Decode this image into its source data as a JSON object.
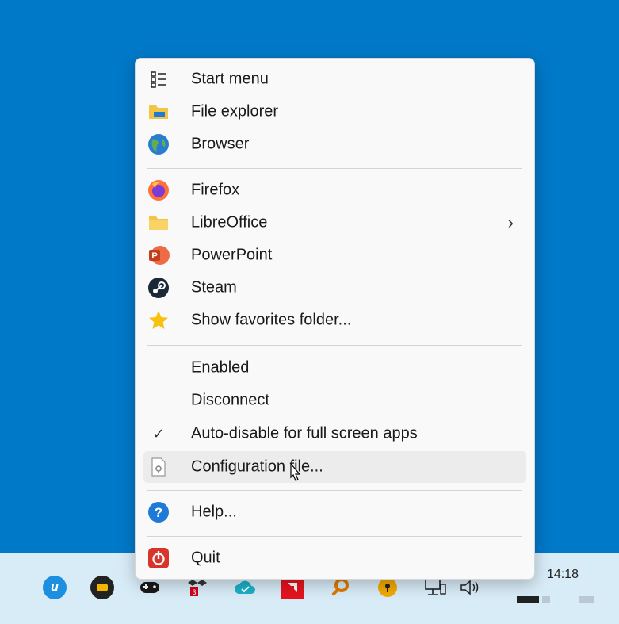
{
  "menu": {
    "items": [
      {
        "label": "Start menu",
        "icon": "start-menu-icon"
      },
      {
        "label": "File explorer",
        "icon": "folder-explorer-icon"
      },
      {
        "label": "Browser",
        "icon": "globe-icon"
      },
      {
        "label": "Firefox",
        "icon": "firefox-icon"
      },
      {
        "label": "LibreOffice",
        "icon": "folder-icon",
        "submenu": true
      },
      {
        "label": "PowerPoint",
        "icon": "powerpoint-icon"
      },
      {
        "label": "Steam",
        "icon": "steam-icon"
      },
      {
        "label": "Show favorites folder...",
        "icon": "star-icon"
      },
      {
        "label": "Enabled"
      },
      {
        "label": "Disconnect"
      },
      {
        "label": "Auto-disable for full screen apps",
        "checked": true
      },
      {
        "label": "Configuration file...",
        "icon": "config-file-icon",
        "hovered": true
      },
      {
        "label": "Help...",
        "icon": "help-icon"
      },
      {
        "label": "Quit",
        "icon": "quit-icon"
      }
    ],
    "submenu_glyph": "›",
    "check_glyph": "✓"
  },
  "taskbar": {
    "clock": "14:18",
    "colors": {
      "desktop": "#0079c8",
      "taskbar": "#d8ecf8"
    }
  }
}
